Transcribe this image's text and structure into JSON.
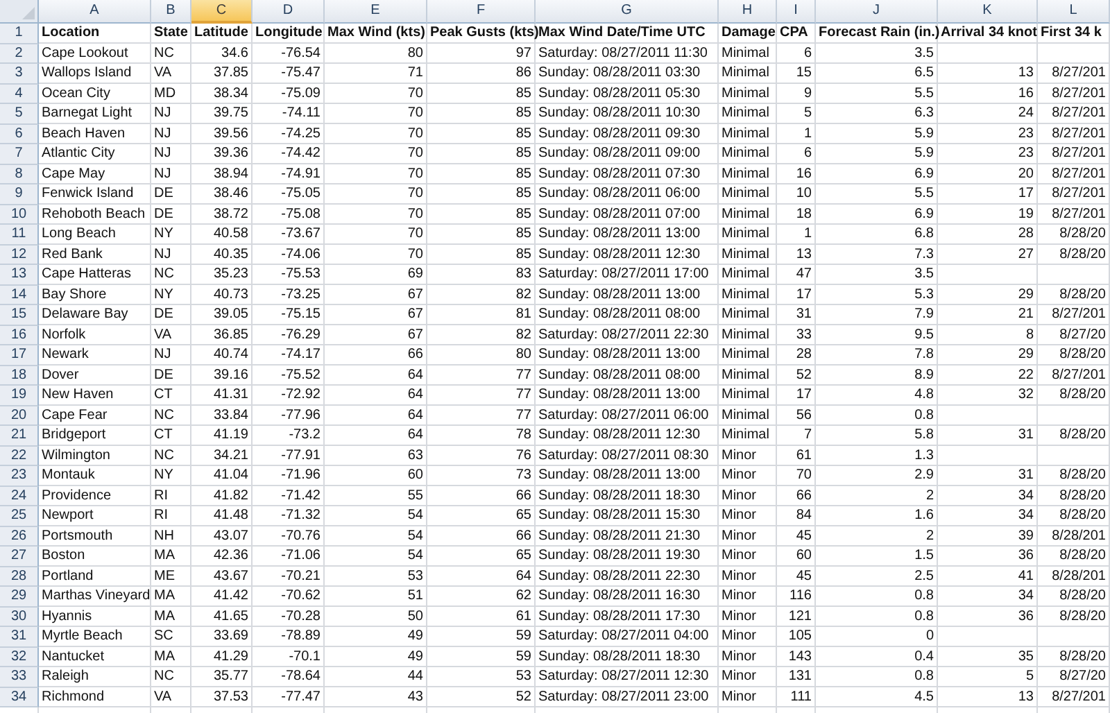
{
  "columns": [
    {
      "letter": "A",
      "kind": "text",
      "selected": false
    },
    {
      "letter": "B",
      "kind": "text",
      "selected": false
    },
    {
      "letter": "C",
      "kind": "number",
      "selected": true
    },
    {
      "letter": "D",
      "kind": "number",
      "selected": false
    },
    {
      "letter": "E",
      "kind": "number",
      "selected": false
    },
    {
      "letter": "F",
      "kind": "number",
      "selected": false
    },
    {
      "letter": "G",
      "kind": "text",
      "selected": false
    },
    {
      "letter": "H",
      "kind": "text",
      "selected": false
    },
    {
      "letter": "I",
      "kind": "number",
      "selected": false
    },
    {
      "letter": "J",
      "kind": "number",
      "selected": false
    },
    {
      "letter": "K",
      "kind": "number",
      "selected": false
    },
    {
      "letter": "L",
      "kind": "number",
      "selected": false
    }
  ],
  "header_row": {
    "number": "1",
    "cells": [
      "Location",
      "State",
      "Latitude",
      "Longitude",
      "Max Wind (kts)",
      "Peak Gusts (kts)",
      "Max Wind Date/Time UTC",
      "Damage",
      "CPA",
      "Forecast Rain (in.)",
      "Arrival 34 knot",
      "First 34 k"
    ]
  },
  "rows": [
    {
      "number": "2",
      "cells": [
        "Cape Lookout",
        "NC",
        "34.6",
        "-76.54",
        "80",
        "97",
        "Saturday: 08/27/2011 11:30",
        "Minimal",
        "6",
        "3.5",
        null,
        null
      ]
    },
    {
      "number": "3",
      "cells": [
        "Wallops Island",
        "VA",
        "37.85",
        "-75.47",
        "71",
        "86",
        "Sunday: 08/28/2011 03:30",
        "Minimal",
        "15",
        "6.5",
        "13",
        "8/27/201"
      ]
    },
    {
      "number": "4",
      "cells": [
        "Ocean City",
        "MD",
        "38.34",
        "-75.09",
        "70",
        "85",
        "Sunday: 08/28/2011 05:30",
        "Minimal",
        "9",
        "5.5",
        "16",
        "8/27/201"
      ]
    },
    {
      "number": "5",
      "cells": [
        "Barnegat Light",
        "NJ",
        "39.75",
        "-74.11",
        "70",
        "85",
        "Sunday: 08/28/2011 10:30",
        "Minimal",
        "5",
        "6.3",
        "24",
        "8/27/201"
      ]
    },
    {
      "number": "6",
      "cells": [
        "Beach Haven",
        "NJ",
        "39.56",
        "-74.25",
        "70",
        "85",
        "Sunday: 08/28/2011 09:30",
        "Minimal",
        "1",
        "5.9",
        "23",
        "8/27/201"
      ]
    },
    {
      "number": "7",
      "cells": [
        "Atlantic City",
        "NJ",
        "39.36",
        "-74.42",
        "70",
        "85",
        "Sunday: 08/28/2011 09:00",
        "Minimal",
        "6",
        "5.9",
        "23",
        "8/27/201"
      ]
    },
    {
      "number": "8",
      "cells": [
        "Cape May",
        "NJ",
        "38.94",
        "-74.91",
        "70",
        "85",
        "Sunday: 08/28/2011 07:30",
        "Minimal",
        "16",
        "6.9",
        "20",
        "8/27/201"
      ]
    },
    {
      "number": "9",
      "cells": [
        "Fenwick Island",
        "DE",
        "38.46",
        "-75.05",
        "70",
        "85",
        "Sunday: 08/28/2011 06:00",
        "Minimal",
        "10",
        "5.5",
        "17",
        "8/27/201"
      ]
    },
    {
      "number": "10",
      "cells": [
        "Rehoboth Beach",
        "DE",
        "38.72",
        "-75.08",
        "70",
        "85",
        "Sunday: 08/28/2011 07:00",
        "Minimal",
        "18",
        "6.9",
        "19",
        "8/27/201"
      ]
    },
    {
      "number": "11",
      "cells": [
        "Long Beach",
        "NY",
        "40.58",
        "-73.67",
        "70",
        "85",
        "Sunday: 08/28/2011 13:00",
        "Minimal",
        "1",
        "6.8",
        "28",
        "8/28/20"
      ]
    },
    {
      "number": "12",
      "cells": [
        "Red Bank",
        "NJ",
        "40.35",
        "-74.06",
        "70",
        "85",
        "Sunday: 08/28/2011 12:30",
        "Minimal",
        "13",
        "7.3",
        "27",
        "8/28/20"
      ]
    },
    {
      "number": "13",
      "cells": [
        "Cape Hatteras",
        "NC",
        "35.23",
        "-75.53",
        "69",
        "83",
        "Saturday: 08/27/2011 17:00",
        "Minimal",
        "47",
        "3.5",
        null,
        null
      ]
    },
    {
      "number": "14",
      "cells": [
        "Bay Shore",
        "NY",
        "40.73",
        "-73.25",
        "67",
        "82",
        "Sunday: 08/28/2011 13:00",
        "Minimal",
        "17",
        "5.3",
        "29",
        "8/28/20"
      ]
    },
    {
      "number": "15",
      "cells": [
        "Delaware Bay",
        "DE",
        "39.05",
        "-75.15",
        "67",
        "81",
        "Sunday: 08/28/2011 08:00",
        "Minimal",
        "31",
        "7.9",
        "21",
        "8/27/201"
      ]
    },
    {
      "number": "16",
      "cells": [
        "Norfolk",
        "VA",
        "36.85",
        "-76.29",
        "67",
        "82",
        "Saturday: 08/27/2011 22:30",
        "Minimal",
        "33",
        "9.5",
        "8",
        "8/27/20"
      ]
    },
    {
      "number": "17",
      "cells": [
        "Newark",
        "NJ",
        "40.74",
        "-74.17",
        "66",
        "80",
        "Sunday: 08/28/2011 13:00",
        "Minimal",
        "28",
        "7.8",
        "29",
        "8/28/20"
      ]
    },
    {
      "number": "18",
      "cells": [
        "Dover",
        "DE",
        "39.16",
        "-75.52",
        "64",
        "77",
        "Sunday: 08/28/2011 08:00",
        "Minimal",
        "52",
        "8.9",
        "22",
        "8/27/201"
      ]
    },
    {
      "number": "19",
      "cells": [
        "New Haven",
        "CT",
        "41.31",
        "-72.92",
        "64",
        "77",
        "Sunday: 08/28/2011 13:00",
        "Minimal",
        "17",
        "4.8",
        "32",
        "8/28/20"
      ]
    },
    {
      "number": "20",
      "cells": [
        "Cape Fear",
        "NC",
        "33.84",
        "-77.96",
        "64",
        "77",
        "Saturday: 08/27/2011 06:00",
        "Minimal",
        "56",
        "0.8",
        null,
        null
      ]
    },
    {
      "number": "21",
      "cells": [
        "Bridgeport",
        "CT",
        "41.19",
        "-73.2",
        "64",
        "78",
        "Sunday: 08/28/2011 12:30",
        "Minimal",
        "7",
        "5.8",
        "31",
        "8/28/20"
      ]
    },
    {
      "number": "22",
      "cells": [
        "Wilmington",
        "NC",
        "34.21",
        "-77.91",
        "63",
        "76",
        "Saturday: 08/27/2011 08:30",
        "Minor",
        "61",
        "1.3",
        null,
        null
      ]
    },
    {
      "number": "23",
      "cells": [
        "Montauk",
        "NY",
        "41.04",
        "-71.96",
        "60",
        "73",
        "Sunday: 08/28/2011 13:00",
        "Minor",
        "70",
        "2.9",
        "31",
        "8/28/20"
      ]
    },
    {
      "number": "24",
      "cells": [
        "Providence",
        "RI",
        "41.82",
        "-71.42",
        "55",
        "66",
        "Sunday: 08/28/2011 18:30",
        "Minor",
        "66",
        "2",
        "34",
        "8/28/20"
      ]
    },
    {
      "number": "25",
      "cells": [
        "Newport",
        "RI",
        "41.48",
        "-71.32",
        "54",
        "65",
        "Sunday: 08/28/2011 15:30",
        "Minor",
        "84",
        "1.6",
        "34",
        "8/28/20"
      ]
    },
    {
      "number": "26",
      "cells": [
        "Portsmouth",
        "NH",
        "43.07",
        "-70.76",
        "54",
        "66",
        "Sunday: 08/28/2011 21:30",
        "Minor",
        "45",
        "2",
        "39",
        "8/28/201"
      ]
    },
    {
      "number": "27",
      "cells": [
        "Boston",
        "MA",
        "42.36",
        "-71.06",
        "54",
        "65",
        "Sunday: 08/28/2011 19:30",
        "Minor",
        "60",
        "1.5",
        "36",
        "8/28/20"
      ]
    },
    {
      "number": "28",
      "cells": [
        "Portland",
        "ME",
        "43.67",
        "-70.21",
        "53",
        "64",
        "Sunday: 08/28/2011 22:30",
        "Minor",
        "45",
        "2.5",
        "41",
        "8/28/201"
      ]
    },
    {
      "number": "29",
      "cells": [
        "Marthas Vineyard",
        "MA",
        "41.42",
        "-70.62",
        "51",
        "62",
        "Sunday: 08/28/2011 16:30",
        "Minor",
        "116",
        "0.8",
        "34",
        "8/28/20"
      ]
    },
    {
      "number": "30",
      "cells": [
        "Hyannis",
        "MA",
        "41.65",
        "-70.28",
        "50",
        "61",
        "Sunday: 08/28/2011 17:30",
        "Minor",
        "121",
        "0.8",
        "36",
        "8/28/20"
      ]
    },
    {
      "number": "31",
      "cells": [
        "Myrtle Beach",
        "SC",
        "33.69",
        "-78.89",
        "49",
        "59",
        "Saturday: 08/27/2011 04:00",
        "Minor",
        "105",
        "0",
        null,
        null
      ]
    },
    {
      "number": "32",
      "cells": [
        "Nantucket",
        "MA",
        "41.29",
        "-70.1",
        "49",
        "59",
        "Sunday: 08/28/2011 18:30",
        "Minor",
        "143",
        "0.4",
        "35",
        "8/28/20"
      ]
    },
    {
      "number": "33",
      "cells": [
        "Raleigh",
        "NC",
        "35.77",
        "-78.64",
        "44",
        "53",
        "Saturday: 08/27/2011 12:30",
        "Minor",
        "131",
        "0.8",
        "5",
        "8/27/20"
      ]
    },
    {
      "number": "34",
      "cells": [
        "Richmond",
        "VA",
        "37.53",
        "-77.47",
        "43",
        "52",
        "Saturday: 08/27/2011 23:00",
        "Minor",
        "111",
        "4.5",
        "13",
        "8/27/201"
      ]
    }
  ]
}
